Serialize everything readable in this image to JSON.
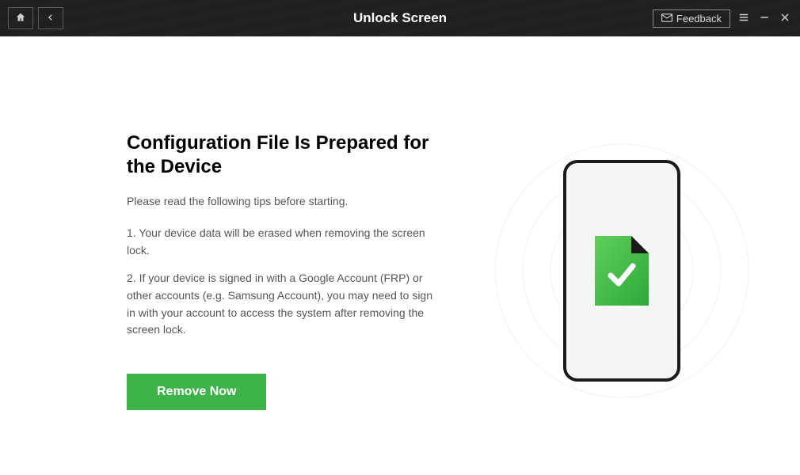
{
  "header": {
    "title": "Unlock Screen",
    "feedback_label": "Feedback"
  },
  "main": {
    "heading": "Configuration File Is Prepared for the Device",
    "subtitle": "Please read the following tips before starting.",
    "tips": [
      "1. Your device data will be erased when removing the screen lock.",
      "2. If your device is signed in with a Google Account (FRP) or other accounts (e.g. Samsung Account), you may need to sign in with your account to access the system after removing the screen lock."
    ],
    "cta_label": "Remove Now"
  },
  "colors": {
    "accent": "#3db349",
    "header_bg": "#1f1f1f"
  }
}
